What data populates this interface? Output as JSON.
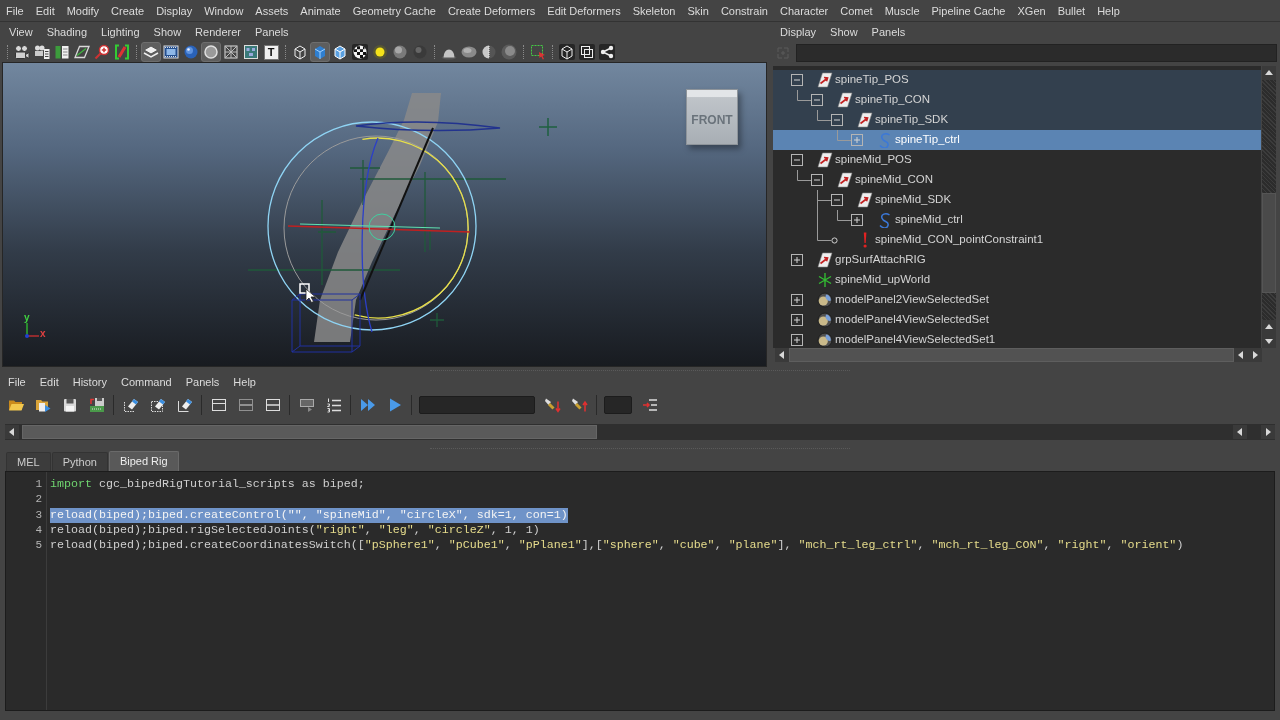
{
  "menu_bar": [
    "File",
    "Edit",
    "Modify",
    "Create",
    "Display",
    "Window",
    "Assets",
    "Animate",
    "Geometry Cache",
    "Create Deformers",
    "Edit Deformers",
    "Skeleton",
    "Skin",
    "Constrain",
    "Character",
    "Comet",
    "Muscle",
    "Pipeline Cache",
    "XGen",
    "Bullet",
    "Help"
  ],
  "viewport_panel": {
    "menu": [
      "View",
      "Shading",
      "Lighting",
      "Show",
      "Renderer",
      "Panels"
    ],
    "toolbar_groups": [
      [
        {
          "kind": "camera",
          "on": false
        },
        {
          "kind": "camera_list",
          "on": false
        },
        {
          "kind": "book",
          "on": false
        },
        {
          "kind": "pan_zoom",
          "on": false
        },
        {
          "kind": "pencil",
          "on": false
        },
        {
          "kind": "gate",
          "on": false
        }
      ],
      [
        {
          "kind": "layers",
          "on": true
        },
        {
          "kind": "film",
          "on": false
        },
        {
          "kind": "blue_sphere",
          "on": false
        },
        {
          "kind": "gray_circle",
          "on": true
        },
        {
          "kind": "wire_box",
          "on": false
        },
        {
          "kind": "texture",
          "on": false
        },
        {
          "kind": "text",
          "label": "T",
          "on": false
        }
      ],
      [
        {
          "kind": "wire_cube",
          "on": false
        },
        {
          "kind": "shaded_cube",
          "on": true
        },
        {
          "kind": "wire_shaded_cube",
          "on": false
        },
        {
          "kind": "checker",
          "on": false
        },
        {
          "kind": "light",
          "on": false
        },
        {
          "kind": "gray_sphere",
          "on": false
        },
        {
          "kind": "dark_sphere",
          "on": false
        }
      ],
      [
        {
          "kind": "figure",
          "on": false
        },
        {
          "kind": "ellipsoid",
          "on": false
        },
        {
          "kind": "half_sphere",
          "on": false
        },
        {
          "kind": "blur_sphere",
          "on": false
        }
      ],
      [
        {
          "kind": "select_rect",
          "on": false
        }
      ],
      [
        {
          "kind": "box_outline",
          "on": false
        },
        {
          "kind": "two_squares",
          "on": false
        },
        {
          "kind": "nodes",
          "on": false
        }
      ]
    ],
    "view_cube": {
      "label": "FRONT"
    },
    "axis_labels": {
      "y": "y",
      "x": "x"
    }
  },
  "outliner": {
    "menu": [
      "Display",
      "Show",
      "Panels"
    ],
    "tree": [
      {
        "label": "spineTip_POS",
        "kind": "transform",
        "expanded": true,
        "selected": false,
        "highlighted": true,
        "children": [
          {
            "label": "spineTip_CON",
            "kind": "transform",
            "expanded": true,
            "selected": false,
            "highlighted": true,
            "children": [
              {
                "label": "spineTip_SDK",
                "kind": "transform",
                "expanded": true,
                "selected": false,
                "highlighted": true,
                "children": [
                  {
                    "label": "spineTip_ctrl",
                    "kind": "curve",
                    "expanded": false,
                    "selected": true,
                    "highlighted": false
                  }
                ]
              }
            ]
          }
        ]
      },
      {
        "label": "spineMid_POS",
        "kind": "transform",
        "expanded": true,
        "selected": false,
        "highlighted": false,
        "children": [
          {
            "label": "spineMid_CON",
            "kind": "transform",
            "expanded": true,
            "selected": false,
            "highlighted": false,
            "children": [
              {
                "label": "spineMid_SDK",
                "kind": "transform",
                "expanded": true,
                "selected": false,
                "highlighted": false,
                "children": [
                  {
                    "label": "spineMid_ctrl",
                    "kind": "curve",
                    "expanded": false,
                    "selected": false,
                    "highlighted": false
                  }
                ]
              },
              {
                "label": "spineMid_CON_pointConstraint1",
                "kind": "constraint",
                "selected": false,
                "highlighted": false
              }
            ]
          }
        ]
      },
      {
        "label": "grpSurfAttachRIG",
        "kind": "transform",
        "expanded": false,
        "selected": false,
        "highlighted": false
      },
      {
        "label": "spineMid_upWorld",
        "kind": "locator",
        "selected": false,
        "highlighted": false
      },
      {
        "label": "modelPanel2ViewSelectedSet",
        "kind": "set",
        "expanded": false,
        "selected": false,
        "highlighted": false
      },
      {
        "label": "modelPanel4ViewSelectedSet",
        "kind": "set",
        "expanded": false,
        "selected": false,
        "highlighted": false
      },
      {
        "label": "modelPanel4ViewSelectedSet1",
        "kind": "set",
        "expanded": false,
        "selected": false,
        "highlighted": false
      }
    ]
  },
  "script_editor": {
    "menu": [
      "File",
      "Edit",
      "History",
      "Command",
      "Panels",
      "Help"
    ],
    "toolbar_groups": [
      [
        {
          "kind": "folder_open"
        },
        {
          "kind": "folder_script"
        },
        {
          "kind": "floppy"
        },
        {
          "kind": "floppy_multi"
        }
      ],
      [
        {
          "kind": "eraser_history"
        },
        {
          "kind": "eraser_input"
        },
        {
          "kind": "eraser_all"
        }
      ],
      [
        {
          "kind": "layout_top"
        },
        {
          "kind": "layout_split"
        },
        {
          "kind": "layout_bottom"
        }
      ],
      [
        {
          "kind": "echo"
        },
        {
          "kind": "line_numbers"
        }
      ],
      [
        {
          "kind": "execute_all"
        },
        {
          "kind": "execute"
        }
      ],
      [
        {
          "kind": "search_field"
        },
        {
          "kind": "search_down"
        },
        {
          "kind": "search_up"
        }
      ],
      [
        {
          "kind": "line_field"
        },
        {
          "kind": "goto_line"
        }
      ]
    ],
    "tabs": [
      {
        "label": "MEL",
        "selected": false
      },
      {
        "label": "Python",
        "selected": false
      },
      {
        "label": "Biped Rig",
        "selected": true
      }
    ],
    "lines": [
      {
        "number": "1",
        "selected": false,
        "tokens": [
          {
            "kind": "keyword",
            "text": "import"
          },
          {
            "kind": "plain",
            "text": " cgc_bipedRigTutorial_scripts as biped;"
          }
        ]
      },
      {
        "number": "2",
        "selected": false
      },
      {
        "number": "3",
        "selected": true,
        "tokens": [
          {
            "kind": "plain",
            "text": "reload(biped);biped.createControl(\"\", \"spineMid\", \"circleX\", sdk=1, con=1)"
          }
        ]
      },
      {
        "number": "4",
        "selected": false,
        "tokens": [
          {
            "kind": "plain",
            "text": "reload(biped);biped.rigSelectedJoints("
          },
          {
            "kind": "string",
            "text": "\"right\""
          },
          {
            "kind": "plain",
            "text": ", "
          },
          {
            "kind": "string",
            "text": "\"leg\""
          },
          {
            "kind": "plain",
            "text": ", "
          },
          {
            "kind": "string",
            "text": "\"circleZ\""
          },
          {
            "kind": "plain",
            "text": ", 1, 1)"
          }
        ]
      },
      {
        "number": "5",
        "selected": false,
        "tokens": [
          {
            "kind": "plain",
            "text": "reload(biped);biped.createCoordinatesSwitch(["
          },
          {
            "kind": "string",
            "text": "\"pSphere1\""
          },
          {
            "kind": "plain",
            "text": ", "
          },
          {
            "kind": "string",
            "text": "\"pCube1\""
          },
          {
            "kind": "plain",
            "text": ", "
          },
          {
            "kind": "string",
            "text": "\"pPlane1\""
          },
          {
            "kind": "plain",
            "text": "],["
          },
          {
            "kind": "string",
            "text": "\"sphere\""
          },
          {
            "kind": "plain",
            "text": ", "
          },
          {
            "kind": "string",
            "text": "\"cube\""
          },
          {
            "kind": "plain",
            "text": ", "
          },
          {
            "kind": "string",
            "text": "\"plane\""
          },
          {
            "kind": "plain",
            "text": "], "
          },
          {
            "kind": "string",
            "text": "\"mch_rt_leg_ctrl\""
          },
          {
            "kind": "plain",
            "text": ", "
          },
          {
            "kind": "string",
            "text": "\"mch_rt_leg_CON\""
          },
          {
            "kind": "plain",
            "text": ", "
          },
          {
            "kind": "string",
            "text": "\"right\""
          },
          {
            "kind": "plain",
            "text": ", "
          },
          {
            "kind": "string",
            "text": "\"orient\""
          },
          {
            "kind": "plain",
            "text": ")"
          }
        ]
      }
    ]
  }
}
